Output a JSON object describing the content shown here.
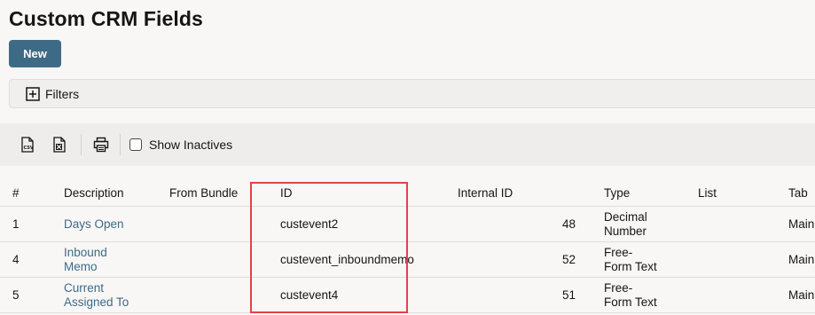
{
  "page": {
    "title": "Custom CRM Fields"
  },
  "actions": {
    "new_label": "New"
  },
  "filters": {
    "label": "Filters"
  },
  "toolbar": {
    "export_csv_icon": "csv-export-icon",
    "export_excel_icon": "excel-export-icon",
    "print_icon": "print-icon",
    "show_inactives_label": "Show Inactives",
    "show_inactives_checked": false
  },
  "table": {
    "headers": {
      "num": "#",
      "description": "Description",
      "from_bundle": "From Bundle",
      "id": "ID",
      "internal_id": "Internal ID",
      "type": "Type",
      "list": "List",
      "tab": "Tab"
    },
    "rows": [
      {
        "num": "1",
        "description": "Days Open",
        "from_bundle": "",
        "id": "custevent2",
        "internal_id": "48",
        "type": "Decimal Number",
        "list": "",
        "tab": "Main"
      },
      {
        "num": "4",
        "description": "Inbound Memo",
        "from_bundle": "",
        "id": "custevent_inboundmemo",
        "internal_id": "52",
        "type": "Free-Form Text",
        "list": "",
        "tab": "Main"
      },
      {
        "num": "5",
        "description": "Current Assigned To",
        "from_bundle": "",
        "id": "custevent4",
        "internal_id": "51",
        "type": "Free-Form Text",
        "list": "",
        "tab": "Main"
      }
    ]
  },
  "colors": {
    "brand": "#3d6b85",
    "link": "#3d6b85",
    "highlight": "#e2424b",
    "background": "#f8f7f6"
  }
}
